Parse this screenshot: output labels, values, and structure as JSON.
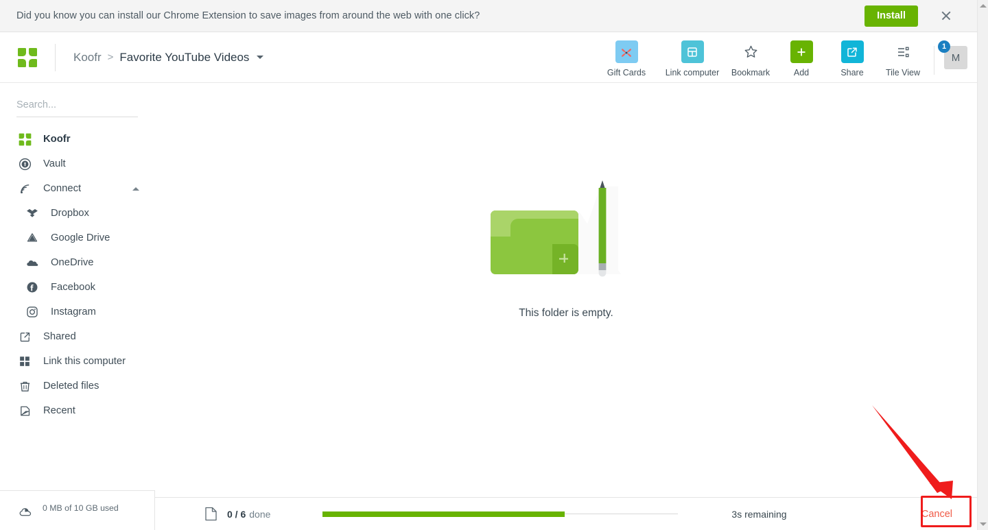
{
  "promo": {
    "message": "Did you know you can install our Chrome Extension to save images from around the web with one click?",
    "install_label": "Install",
    "close_icon": "close-icon",
    "install_color": "#68b302"
  },
  "header": {
    "logo_icon": "koofr-logo-icon",
    "breadcrumb": {
      "root": "Koofr",
      "separator": ">",
      "current": "Favorite YouTube Videos",
      "caret_icon": "chevron-down-icon"
    },
    "actions": [
      {
        "label": "Gift Cards",
        "icon": "gift-ribbon-icon",
        "tile_color": "#7ecbf2",
        "style": "tile"
      },
      {
        "label": "Link computer",
        "icon": "computer-icon",
        "tile_color": "#4ec3d8",
        "style": "tile"
      },
      {
        "label": "Bookmark",
        "icon": "star-outline-icon",
        "tile_color": "",
        "style": "plain"
      },
      {
        "label": "Add",
        "icon": "plus-icon",
        "tile_color": "#68b302",
        "style": "tile"
      },
      {
        "label": "Share",
        "icon": "share-icon",
        "tile_color": "#11b5d8",
        "style": "tile"
      },
      {
        "label": "Tile View",
        "icon": "tile-view-icon",
        "tile_color": "",
        "style": "plain"
      }
    ],
    "avatar": {
      "initial": "M",
      "badge_count": "1",
      "badge_color": "#1a7fc1"
    }
  },
  "sidebar": {
    "search": {
      "placeholder": "Search...",
      "value": ""
    },
    "items": [
      {
        "label": "Koofr",
        "icon": "koofr-logo-icon",
        "level": 0,
        "bold": true
      },
      {
        "label": "Vault",
        "icon": "vault-lock-icon",
        "level": 0,
        "bold": false
      },
      {
        "label": "Connect",
        "icon": "connect-signal-icon",
        "level": 0,
        "bold": false,
        "collapse_icon": "chevron-up-icon"
      },
      {
        "label": "Dropbox",
        "icon": "dropbox-icon",
        "level": 1,
        "bold": false
      },
      {
        "label": "Google Drive",
        "icon": "google-drive-icon",
        "level": 1,
        "bold": false
      },
      {
        "label": "OneDrive",
        "icon": "onedrive-icon",
        "level": 1,
        "bold": false
      },
      {
        "label": "Facebook",
        "icon": "facebook-icon",
        "level": 1,
        "bold": false
      },
      {
        "label": "Instagram",
        "icon": "instagram-icon",
        "level": 1,
        "bold": false
      },
      {
        "label": "Shared",
        "icon": "shared-icon",
        "level": 0,
        "bold": false
      },
      {
        "label": "Link this computer",
        "icon": "grid-squares-icon",
        "level": 0,
        "bold": false
      },
      {
        "label": "Deleted files",
        "icon": "trash-icon",
        "level": 0,
        "bold": false
      },
      {
        "label": "Recent",
        "icon": "recent-file-icon",
        "level": 0,
        "bold": false
      }
    ],
    "storage": {
      "icon": "cloud-icon",
      "text": "0 MB of 10 GB used",
      "used_percent": 0
    }
  },
  "main": {
    "empty_state": {
      "illustration": "empty-folder-with-pencil-illustration",
      "caption": "This folder is empty.",
      "folder_color": "#8cc63f",
      "pencil_color": "#6ab023"
    }
  },
  "statusbar": {
    "file_icon": "file-icon",
    "count": "0 / 6",
    "done_label": "done",
    "progress_percent": 68,
    "progress_color": "#68b302",
    "time_remaining": "3s remaining",
    "cancel_label": "Cancel",
    "cancel_color": "#f05a46"
  },
  "annotations": {
    "highlight_box": "cancel-button-highlight",
    "arrow": "pointer-arrow-to-cancel",
    "color": "#ef1c1c"
  },
  "scrollbar": {
    "up_arrow_icon": "scroll-up-arrow-icon",
    "down_arrow_icon": "scroll-down-arrow-icon"
  }
}
